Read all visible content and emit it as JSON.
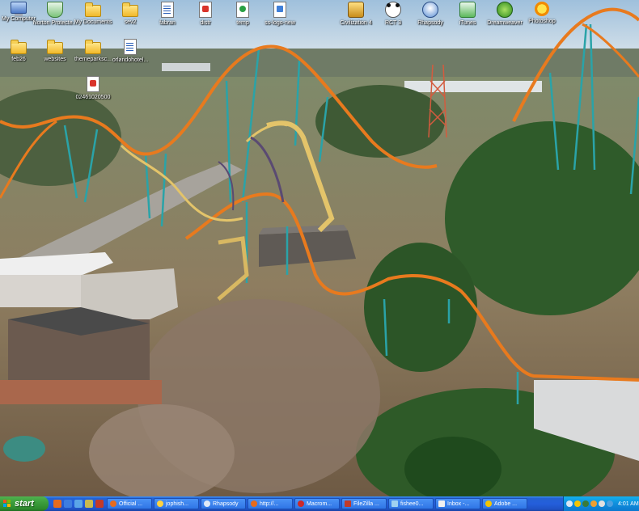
{
  "desktop": {
    "icons": [
      {
        "label": "My Computer",
        "icon": "computer-icon"
      },
      {
        "label": "Norton Protecte...",
        "icon": "norton-shield-icon"
      },
      {
        "label": "My Documents",
        "icon": "documents-folder-icon"
      },
      {
        "label": "sev2",
        "icon": "folder-icon"
      },
      {
        "label": "fabran",
        "icon": "word-document-icon"
      },
      {
        "label": "distr",
        "icon": "pdf-document-icon"
      },
      {
        "label": "temp",
        "icon": "setup-file-icon"
      },
      {
        "label": "ss-logo-new",
        "icon": "image-file-icon"
      },
      {
        "label": "Civilization 4",
        "icon": "civilization-icon"
      },
      {
        "label": "RCT 3",
        "icon": "rct3-panda-icon"
      },
      {
        "label": "Rhapsody",
        "icon": "rhapsody-icon"
      },
      {
        "label": "iTunes",
        "icon": "itunes-icon"
      },
      {
        "label": "Dreamweaver",
        "icon": "dreamweaver-icon"
      },
      {
        "label": "Photoshop",
        "icon": "photoshop-icon"
      },
      {
        "label": "feb26",
        "icon": "folder-icon"
      },
      {
        "label": "websites",
        "icon": "folder-icon"
      },
      {
        "label": "themeparksc...",
        "icon": "folder-icon"
      },
      {
        "label": "orlandohotel...",
        "icon": "text-file-icon"
      },
      {
        "label": "02461020500",
        "icon": "image-file-icon"
      }
    ]
  },
  "taskbar": {
    "start_label": "start",
    "tasks": [
      {
        "label": "Official ...",
        "icon": "firefox-icon"
      },
      {
        "label": "jophish...",
        "icon": "messenger-icon"
      },
      {
        "label": "Rhapsody",
        "icon": "rhapsody-icon"
      },
      {
        "label": "http://...",
        "icon": "firefox-icon"
      },
      {
        "label": "Macrom...",
        "icon": "macromedia-icon"
      },
      {
        "label": "FileZilla ...",
        "icon": "filezilla-icon"
      },
      {
        "label": "fishee0...",
        "icon": "image-viewer-icon"
      },
      {
        "label": "Inbox -...",
        "icon": "mail-icon"
      },
      {
        "label": "Adobe ...",
        "icon": "adobe-icon"
      }
    ],
    "clock": "4:01 AM"
  },
  "colors": {
    "taskbar_blue": "#245edb",
    "start_green": "#3c9e3c",
    "tray_blue": "#0f8edc",
    "coaster_orange": "#e87a1e",
    "coaster_teal": "#2aa3a8",
    "coaster_yellow": "#e3c46a"
  }
}
